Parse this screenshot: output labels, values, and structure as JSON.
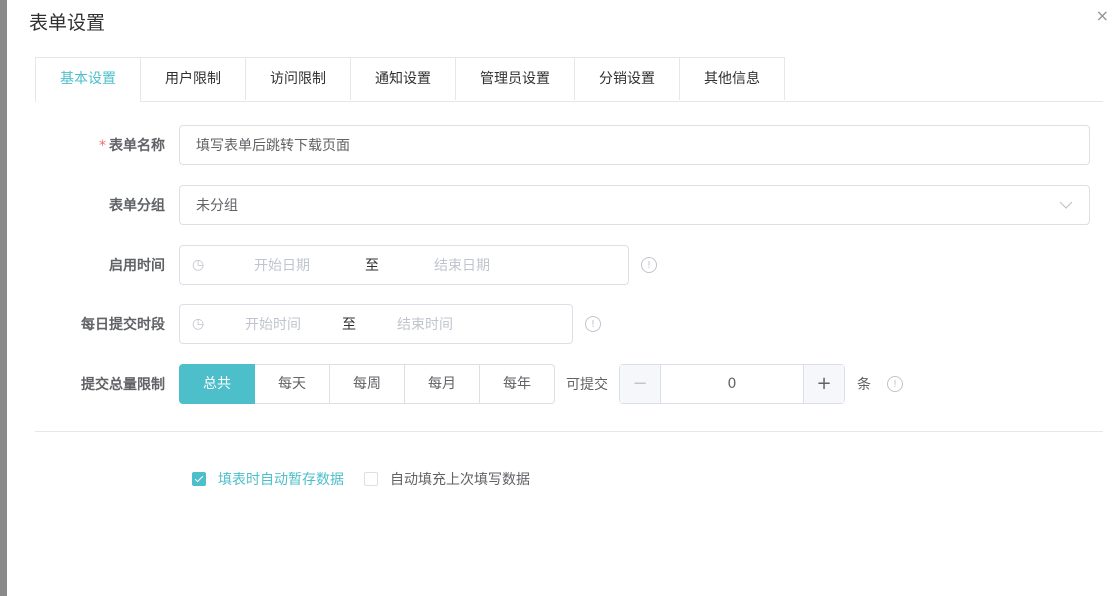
{
  "dialog": {
    "title": "表单设置",
    "close_glyph": "×"
  },
  "tabs": [
    {
      "label": "基本设置",
      "active": true
    },
    {
      "label": "用户限制"
    },
    {
      "label": "访问限制"
    },
    {
      "label": "通知设置"
    },
    {
      "label": "管理员设置"
    },
    {
      "label": "分销设置"
    },
    {
      "label": "其他信息"
    }
  ],
  "form": {
    "name": {
      "required_mark": "*",
      "label": "表单名称",
      "value": "填写表单后跳转下载页面"
    },
    "group": {
      "label": "表单分组",
      "value": "未分组",
      "arrow_icon": "chevron-down-icon"
    },
    "enable_time": {
      "label": "启用时间",
      "start_placeholder": "开始日期",
      "separator": "至",
      "end_placeholder": "结束日期"
    },
    "daily_period": {
      "label": "每日提交时段",
      "start_placeholder": "开始时间",
      "separator": "至",
      "end_placeholder": "结束时间"
    },
    "submit_limit": {
      "label": "提交总量限制",
      "options": [
        "总共",
        "每天",
        "每周",
        "每月",
        "每年"
      ],
      "selected": "总共",
      "can_submit_label": "可提交",
      "count": "0",
      "minus": "−",
      "plus": "+",
      "unit": "条"
    }
  },
  "options": {
    "auto_save": {
      "label": "填表时自动暂存数据",
      "checked": true
    },
    "auto_fill": {
      "label": "自动填充上次填写数据",
      "checked": false
    }
  },
  "colors": {
    "accent": "#4cbfcb",
    "required": "#f56c6c",
    "border": "#dcdfe6"
  }
}
